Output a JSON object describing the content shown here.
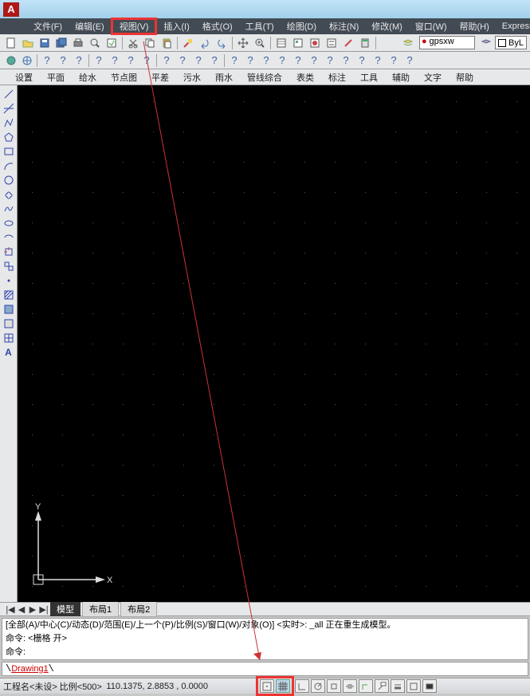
{
  "title": "",
  "menubar": [
    "文件(F)",
    "编辑(E)",
    "视图(V)",
    "插入(I)",
    "格式(O)",
    "工具(T)",
    "绘图(D)",
    "标注(N)",
    "修改(M)",
    "窗口(W)",
    "帮助(H)",
    "Express"
  ],
  "layer_name": "gpsxw",
  "bylayer": "ByL",
  "submenu": [
    "设置",
    "平面",
    "给水",
    "节点图",
    "平差",
    "污水",
    "雨水",
    "管线综合",
    "表类",
    "标注",
    "工具",
    "辅助",
    "文字",
    "帮助"
  ],
  "ucs": {
    "x": "X",
    "y": "Y"
  },
  "tabs": {
    "nav": [
      "|◀",
      "◀",
      "▶",
      "▶|"
    ],
    "active": "模型",
    "others": [
      "布局1",
      "布局2"
    ]
  },
  "cmd": {
    "l1": "[全部(A)/中心(C)/动态(D)/范围(E)/上一个(P)/比例(S)/窗口(W)/对象(O)] <实时>: _all 正在重生成模型。",
    "l2": "命令:  <栅格 开>",
    "l3": "命令:"
  },
  "drawing": "Drawing1",
  "status": {
    "proj": "工程名<未设>",
    "scale": "比例<500>",
    "coords": "110.1375, 2.8853 , 0.0000"
  }
}
